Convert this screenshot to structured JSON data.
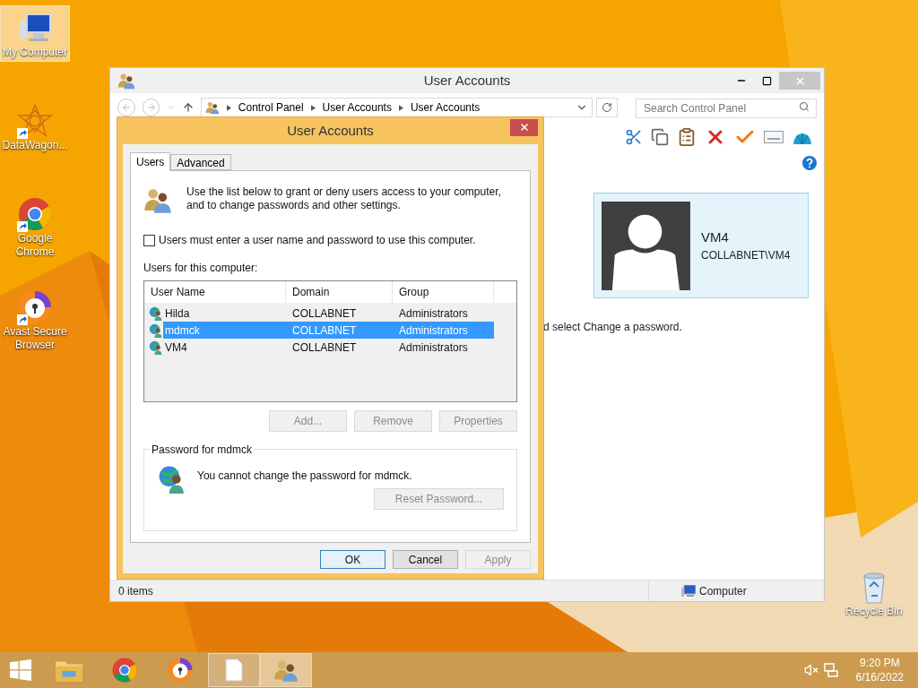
{
  "desktop_icons": [
    {
      "kind": "computer",
      "label": "My Computer",
      "selected": true
    },
    {
      "kind": "datawagon",
      "label": "DataWagon...",
      "selected": false
    },
    {
      "kind": "chrome",
      "label": "Google Chrome",
      "selected": false
    },
    {
      "kind": "avast",
      "label": "Avast Secure Browser",
      "selected": false
    },
    {
      "kind": "recycle",
      "label": "Recycle Bin",
      "selected": false
    }
  ],
  "explorer": {
    "title": "User Accounts",
    "breadcrumb": [
      "Control Panel",
      "User Accounts",
      "User Accounts"
    ],
    "search_placeholder": "Search Control Panel",
    "user_card": {
      "name": "VM4",
      "account": "COLLABNET\\VM4"
    },
    "instruction": "d select Change a password.",
    "status_items": "0 items",
    "status_location": "Computer"
  },
  "dialog": {
    "title": "User Accounts",
    "tabs": [
      {
        "label": "Users",
        "selected": true
      },
      {
        "label": "Advanced",
        "selected": false
      }
    ],
    "intro": "Use the list below to grant or deny users access to your computer, and to change passwords and other settings.",
    "checkbox": {
      "label": "Users must enter a user name and password to use this computer.",
      "checked": false
    },
    "list_label": "Users for this computer:",
    "columns": [
      "User Name",
      "Domain",
      "Group"
    ],
    "rows": [
      {
        "user_name": "Hilda",
        "domain": "COLLABNET",
        "group": "Administrators",
        "selected": false
      },
      {
        "user_name": "mdmck",
        "domain": "COLLABNET",
        "group": "Administrators",
        "selected": true
      },
      {
        "user_name": "VM4",
        "domain": "COLLABNET",
        "group": "Administrators",
        "selected": false
      }
    ],
    "list_buttons": [
      {
        "label": "Add...",
        "disabled": true
      },
      {
        "label": "Remove",
        "disabled": true
      },
      {
        "label": "Properties",
        "disabled": true
      }
    ],
    "password_group": {
      "title": "Password for mdmck",
      "message": "You cannot change the password for mdmck.",
      "button": {
        "label": "Reset Password...",
        "disabled": true
      }
    },
    "footer_buttons": [
      {
        "label": "OK",
        "disabled": false,
        "default": true
      },
      {
        "label": "Cancel",
        "disabled": false,
        "default": false
      },
      {
        "label": "Apply",
        "disabled": true,
        "default": false
      }
    ]
  },
  "taskbar": {
    "buttons": [
      {
        "kind": "start",
        "running": false,
        "active": false
      },
      {
        "kind": "files",
        "running": false,
        "active": false
      },
      {
        "kind": "chrome",
        "running": false,
        "active": false
      },
      {
        "kind": "avast",
        "running": false,
        "active": false
      },
      {
        "kind": "document",
        "running": true,
        "active": false
      },
      {
        "kind": "users",
        "running": true,
        "active": true
      }
    ],
    "time": "9:20 PM",
    "date": "6/16/2022"
  }
}
